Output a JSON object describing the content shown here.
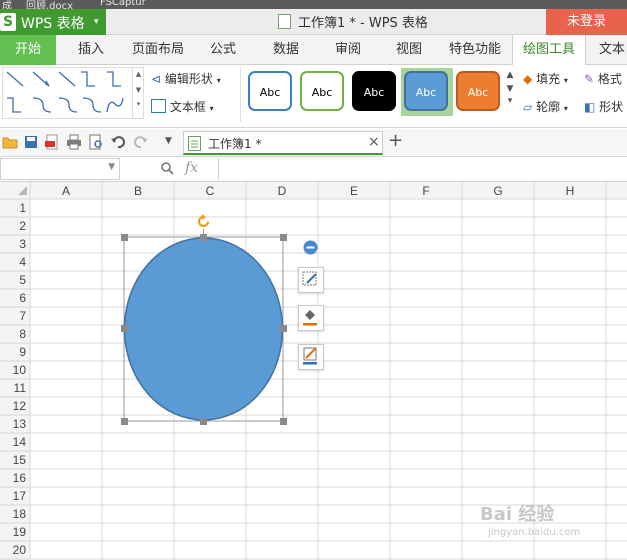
{
  "top_strip": {
    "items": [
      "成",
      "回顾.docx",
      "FSCaptur"
    ]
  },
  "app": {
    "logo_letter": "S",
    "name": "WPS 表格",
    "caret": "▾"
  },
  "window": {
    "title": "工作簿1 * - WPS 表格",
    "login_label": "未登录"
  },
  "ribbon": {
    "tabs": [
      "开始",
      "插入",
      "页面布局",
      "公式",
      "数据",
      "审阅",
      "视图",
      "特色功能",
      "绘图工具",
      "文本"
    ],
    "edit_shape_label": "编辑形状",
    "text_box_label": "文本框",
    "fill_label": "填充",
    "format_label": "格式",
    "outline_label": "轮廓",
    "shape_label": "形状",
    "style_swatches": [
      {
        "text": "Abc",
        "bg": "#ffffff",
        "border": "#3d7fc4",
        "color": "#000000"
      },
      {
        "text": "Abc",
        "bg": "#ffffff",
        "border": "#6fb04a",
        "color": "#000000"
      },
      {
        "text": "Abc",
        "bg": "#000000",
        "border": "#000000",
        "color": "#ffffff"
      },
      {
        "text": "Abc",
        "bg": "#5b9bd5",
        "border": "#41719c",
        "color": "#ffffff"
      },
      {
        "text": "Abc",
        "bg": "#ed7d31",
        "border": "#c05a1c",
        "color": "#ffffff"
      }
    ],
    "selected_style_index": 3
  },
  "quick_toolbar": {
    "doc_tab_label": "工作簿1 *",
    "close_glyph": "×",
    "add_glyph": "+"
  },
  "formula_bar": {
    "fx_label": "fx",
    "zoom_icon": "search-icon"
  },
  "sheet": {
    "columns": [
      "A",
      "B",
      "C",
      "D",
      "E",
      "F",
      "G",
      "H"
    ],
    "rows": [
      "1",
      "2",
      "3",
      "4",
      "5",
      "6",
      "7",
      "8",
      "9",
      "10",
      "11",
      "12",
      "13",
      "14",
      "15",
      "16",
      "17",
      "18",
      "19",
      "20"
    ]
  },
  "shape": {
    "type": "ellipse",
    "fill": "#5b9bd5",
    "stroke": "#41719c",
    "rotate_handle_color": "#f0a020"
  },
  "colors": {
    "wps_green": "#3f9a2f",
    "login_red": "#e8634b",
    "tab_green": "#63bf4f"
  },
  "watermark": {
    "text": "Bai 经验",
    "subtext": "jingyan.baidu.com"
  }
}
